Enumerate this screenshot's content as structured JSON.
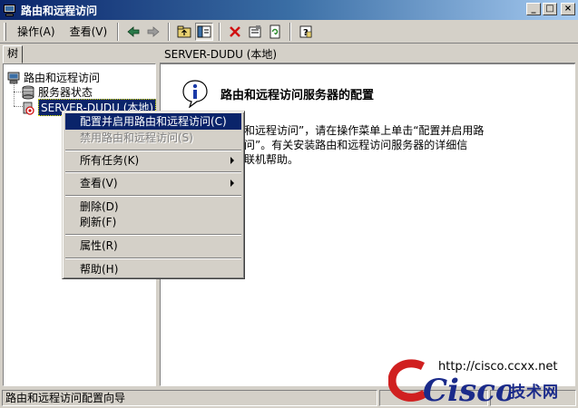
{
  "window": {
    "title": "路由和远程访问",
    "buttons": [
      "_",
      "□",
      "×"
    ]
  },
  "menu": {
    "action": "操作(A)",
    "view": "查看(V)"
  },
  "toolbar": {
    "icons": [
      "back-icon",
      "forward-icon",
      "up-folder-icon",
      "show-tree-icon",
      "delete-icon",
      "properties-icon",
      "refresh-icon",
      "help-icon"
    ]
  },
  "left": {
    "tab_label": "树",
    "tree": {
      "root": "路由和远程访问",
      "server_status": "服务器状态",
      "server": "SERVER-DUDU (本地)"
    }
  },
  "right": {
    "header": "SERVER-DUDU (本地)",
    "heading": "路由和远程访问服务器的配置",
    "body_lines": [
      "和远程访问”，请在操作菜单上单击“配置并启用路",
      "问”。有关安装路由和远程访问服务器的详细信",
      "联机帮助。"
    ]
  },
  "context_menu": {
    "configure": "配置并启用路由和远程访问(C)",
    "disable": "禁用路由和远程访问(S)",
    "all_tasks": "所有任务(K)",
    "view": "查看(V)",
    "delete": "删除(D)",
    "refresh": "刷新(F)",
    "properties": "属性(R)",
    "help": "帮助(H)"
  },
  "status_bar": {
    "text": "路由和远程访问配置向导"
  },
  "watermark": {
    "url": "http://cisco.ccxx.net",
    "logo_text": "Cisco",
    "tagline": "技术网"
  }
}
